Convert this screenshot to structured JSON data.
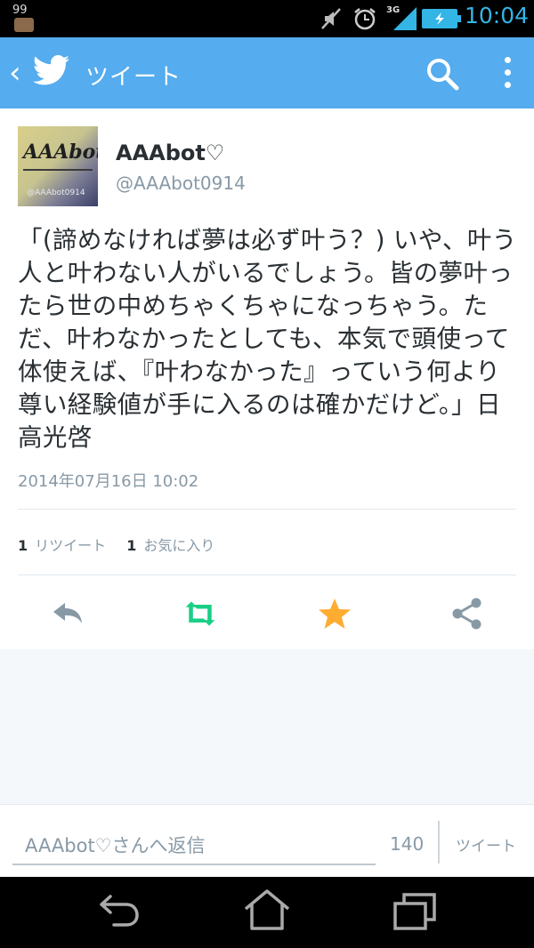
{
  "status_bar": {
    "battery_pct": "99",
    "network": "3G",
    "time": "10:04"
  },
  "action_bar": {
    "title": "ツイート"
  },
  "tweet": {
    "display_name": "AAAbot♡",
    "handle": "@AAAbot0914",
    "avatar_text": "AAAbot",
    "avatar_sub": "@AAAbot0914",
    "text": "「(諦めなければ夢は必ず叶う？) いや、叶う人と叶わない人がいるでしょう。皆の夢叶ったら世の中めちゃくちゃになっちゃう。ただ、叶わなかったとしても、本気で頭使って体使えば、『叶わなかった』っていう何より尊い経験値が手に入るのは確かだけど。」日高光啓",
    "timestamp": "2014年07月16日 10:02",
    "retweet_count": "1",
    "retweet_label": "リツイート",
    "favorite_count": "1",
    "favorite_label": "お気に入り"
  },
  "composer": {
    "placeholder": "AAAbot♡さんへ返信",
    "char_count": "140",
    "tweet_button": "ツイート"
  },
  "colors": {
    "brand": "#55acee",
    "retweet": "#19cf86",
    "favorite": "#ffac33",
    "status_accent": "#33b5e5"
  },
  "icons": [
    "twitter-bird-icon",
    "search-icon",
    "more-icon",
    "reply-icon",
    "retweet-icon",
    "favorite-icon",
    "share-icon",
    "back-nav-icon",
    "home-nav-icon",
    "recent-apps-icon"
  ]
}
